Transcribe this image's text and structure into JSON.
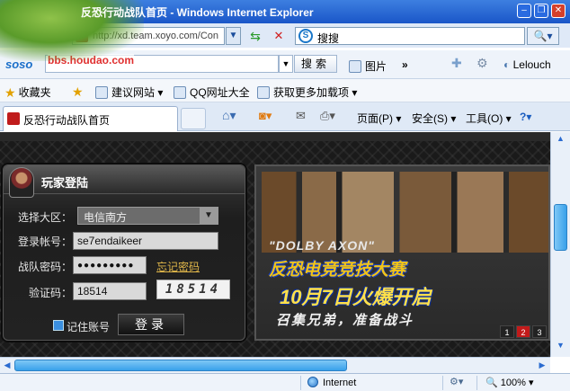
{
  "window": {
    "title": "反恐行动战队首页 - Windows Internet Explorer",
    "minimize": "–",
    "restore": "❐",
    "close": "✕"
  },
  "address_bar": {
    "url": "http://xd.team.xoyo.com/Con",
    "dropdown": "▼",
    "refresh": "⇆",
    "stop": "✕",
    "search_text": "搜搜",
    "search_go": "🔍▾"
  },
  "soso_toolbar": {
    "logo": "soso",
    "watermark": "bbs.houdao.com",
    "search_button": "搜索",
    "picture_label": "图片",
    "more": "»",
    "user": "Lelouch"
  },
  "favorites_bar": {
    "favorites_label": "收藏夹",
    "items": [
      "建议网站 ▾",
      "QQ网址大全",
      "获取更多加载项 ▾"
    ]
  },
  "tab_bar": {
    "active_tab": "反恐行动战队首页",
    "commands": {
      "page": "页面(P) ▾",
      "safety": "安全(S) ▾",
      "tools": "工具(O) ▾",
      "help": "?▾"
    }
  },
  "login": {
    "title": "玩家登陆",
    "server_label": "选择大区：",
    "server_value": "电信南方",
    "account_label": "登录帐号：",
    "account_value": "se7endaikeer",
    "password_label": "战队密码：",
    "password_value": "●●●●●●●●●",
    "forgot_link": "忘记密码",
    "captcha_label": "验证码：",
    "captcha_value": "18514",
    "captcha_image_text": "18514",
    "remember_label": "记住账号",
    "login_button": "登录"
  },
  "banner": {
    "sponsor_line": "\"DOLBY AXON\"",
    "event_title": "反恐电竞竞技大赛",
    "date_line": "10月7日火爆开启",
    "call_line": "召集兄弟，准备战斗",
    "pager": [
      "1",
      "2",
      "3"
    ],
    "active_page": "2"
  },
  "status_bar": {
    "zone": "Internet",
    "zoom": "100%"
  },
  "colors": {
    "titlebar": "#1a56c8",
    "login_panel": "#222222",
    "banner_yellow": "#f2c418",
    "pager_active": "#c21a1a"
  }
}
